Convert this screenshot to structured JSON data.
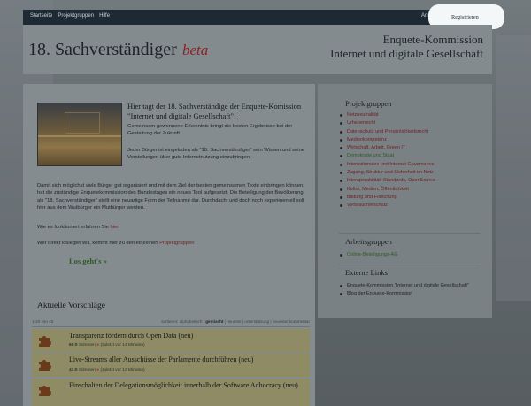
{
  "topbar": {
    "nav": [
      "Startseite",
      "Projektgruppen",
      "Hilfe"
    ],
    "anmelden": "Anmelden",
    "registrieren": "Registrieren"
  },
  "header": {
    "site_title": "18. Sachverständiger",
    "beta": "beta",
    "line1": "Enquete-Kommission",
    "line2": "Internet und digitale Gesellschaft"
  },
  "hero": {
    "title": "Hier tagt der 18. Sachverständige der Enquete-Komission \"Internet und digitale Gesellschaft\"!",
    "p1": "Gemeinsam gewonnene Erkenntnis bringt die besten Ergebnisse bei der Gestaltung der Zukunft.",
    "p2": "Jeder Bürger ist eingeladen als \"18. Sachverständiger\" sein Wissen und seine Vorstellungen über gute Internetnutzung einzubringen.",
    "p3": "Damit sich möglichst viele Bürger gut organisiert und mit dem Ziel der besten gemeinsamen Texte einbringen können, hat die zuständige Enquetekommission des Bundestages ein neues Tool aufgesetzt. Die Beteiligung der Bevölkerung als \"18. Sachverständiger\" stellt eine neuartige Form der Teilnahme dar. Durchdacht und doch noch experimentell soll hier aus dem Wutbürger ein Mutbürger werden.",
    "p4_prefix": "Wie es funktioniert erfahren Sie ",
    "p4_link": "hier",
    "p5_prefix": "Wer direkt loslegen will, kommt hier zu den einzelnen ",
    "p5_link": "Projektgruppen",
    "cta": "Los geht's »"
  },
  "proposals": {
    "heading": "Aktuelle Vorschläge",
    "range": "1-20 von 45",
    "sort_label": "sortieren:",
    "sort_options": [
      "alphabetisch",
      "gemischt",
      "neueste",
      "unterstützung",
      "neuester kommentar"
    ],
    "sort_active": "gemischt",
    "items": [
      {
        "title": "Transparenz fördern durch Open Data",
        "badge": "(neu)",
        "votes": "60:0",
        "votes_label": "Stimmen",
        "meta": "(zuletzt vor 14 Minuten)"
      },
      {
        "title": "Live-Streams aller Ausschüsse der Parlamente durchführen",
        "badge": "(neu)",
        "votes": "43:0",
        "votes_label": "Stimmen",
        "meta": "(zuletzt vor 12 Minuten)"
      },
      {
        "title": "Einschalten der Delegationsmöglichkeit innerhalb der Software Adhocracy",
        "badge": "(neu)",
        "votes": "",
        "votes_label": "",
        "meta": ""
      }
    ]
  },
  "sidebar": {
    "projektgruppen_heading": "Projektgruppen",
    "projektgruppen": [
      "Netzneutralität",
      "Urheberrecht",
      "Datenschutz und Persönlichkeitsrecht",
      "Medienkompetenz",
      "Wirtschaft, Arbeit, Green IT",
      "Demokratie und Staat",
      "Internationales und Internet Governance",
      "Zugang, Struktur und Sicherheit im Netz",
      "Interoperabilität, Standards, OpenSource",
      "Kultur, Medien, Öffentlichkeit",
      "Bildung und Forschung",
      "Verbraucherschutz"
    ],
    "arbeitsgruppen_heading": "Arbeitsgruppen",
    "arbeitsgruppen": [
      "Online-Beteiligungs-AG"
    ],
    "externe_heading": "Externe Links",
    "externe": [
      "Enquete-Kommission \"Internet und digitale Gesellschaft\"",
      "Blog der Enquete-Kommission"
    ]
  },
  "colors": {
    "accent_red": "#8c1f1f",
    "accent_green": "#2d5a1e",
    "topbar": "#1d2a33"
  }
}
